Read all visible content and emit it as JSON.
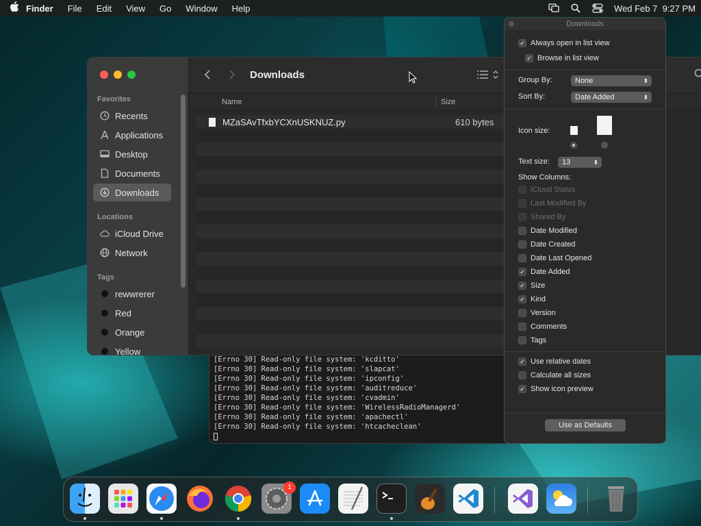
{
  "menubar": {
    "app": "Finder",
    "items": [
      "File",
      "Edit",
      "View",
      "Go",
      "Window",
      "Help"
    ],
    "clock": "Wed Feb 7  9:27 PM",
    "icons": [
      "screen-mirroring-icon",
      "spotlight-search-icon",
      "control-center-icon"
    ]
  },
  "finder": {
    "title": "Downloads",
    "sidebar": {
      "favorites_label": "Favorites",
      "favorites": [
        "Recents",
        "Applications",
        "Desktop",
        "Documents",
        "Downloads"
      ],
      "locations_label": "Locations",
      "locations": [
        "iCloud Drive",
        "Network"
      ],
      "tags_label": "Tags",
      "tags": [
        "rewwrerer",
        "Red",
        "Orange",
        "Yellow"
      ]
    },
    "columns": {
      "name": "Name",
      "size": "Size"
    },
    "files": [
      {
        "name": "MZaSAvTfxbYCXnUSKNUZ.py",
        "size": "610 bytes"
      }
    ]
  },
  "terminal": {
    "lines": [
      "[Errno 30] Read-only file system: 'kcditto'",
      "[Errno 30] Read-only file system: 'slapcat'",
      "[Errno 30] Read-only file system: 'ipconfig'",
      "[Errno 30] Read-only file system: 'auditreduce'",
      "[Errno 30] Read-only file system: 'cvadmin'",
      "[Errno 30] Read-only file system: 'WirelessRadioManagerd'",
      "[Errno 30] Read-only file system: 'apachectl'",
      "[Errno 30] Read-only file system: 'htcacheclean'"
    ]
  },
  "view_options": {
    "title": "Downloads",
    "always_open": "Always open in list view",
    "browse": "Browse in list view",
    "group_by_label": "Group By:",
    "group_by_value": "None",
    "sort_by_label": "Sort By:",
    "sort_by_value": "Date Added",
    "icon_size_label": "Icon size:",
    "text_size_label": "Text size:",
    "text_size_value": "13",
    "show_columns_label": "Show Columns:",
    "columns": [
      {
        "label": "iCloud Status",
        "checked": false,
        "disabled": true
      },
      {
        "label": "Last Modified By",
        "checked": false,
        "disabled": true
      },
      {
        "label": "Shared By",
        "checked": false,
        "disabled": true
      },
      {
        "label": "Date Modified",
        "checked": false,
        "disabled": false
      },
      {
        "label": "Date Created",
        "checked": false,
        "disabled": false
      },
      {
        "label": "Date Last Opened",
        "checked": false,
        "disabled": false
      },
      {
        "label": "Date Added",
        "checked": true,
        "disabled": false
      },
      {
        "label": "Size",
        "checked": true,
        "disabled": false
      },
      {
        "label": "Kind",
        "checked": true,
        "disabled": false
      },
      {
        "label": "Version",
        "checked": false,
        "disabled": false
      },
      {
        "label": "Comments",
        "checked": false,
        "disabled": false
      },
      {
        "label": "Tags",
        "checked": false,
        "disabled": false
      }
    ],
    "relative_dates": "Use relative dates",
    "calc_sizes": "Calculate all sizes",
    "icon_preview": "Show icon preview",
    "defaults_button": "Use as Defaults"
  },
  "dock": {
    "apps": [
      "Finder",
      "Launchpad",
      "Safari",
      "Firefox",
      "Chrome",
      "System Settings",
      "App Store",
      "TextEdit",
      "Terminal",
      "GarageBand",
      "Visual Studio Code",
      "Visual Studio",
      "Weather",
      "Trash"
    ],
    "settings_badge": "1"
  }
}
